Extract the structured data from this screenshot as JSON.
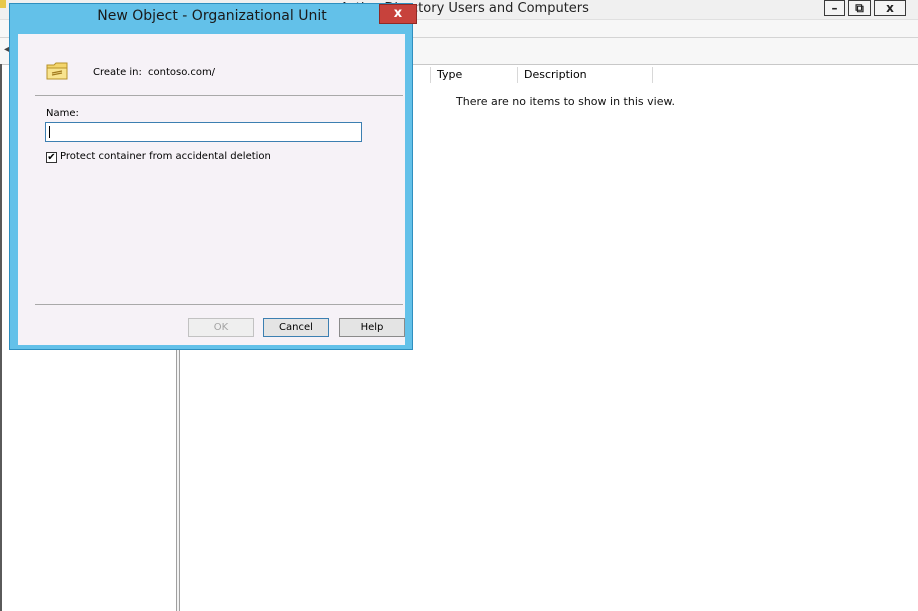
{
  "mmc": {
    "title": "Active Directory Users and Computers",
    "window_buttons": {
      "minimize": "–",
      "restore": "⧉",
      "close": "x"
    },
    "columns": {
      "name": "",
      "type": "Type",
      "description": "Description"
    },
    "empty_message": "There are no items to show in this view."
  },
  "dialog": {
    "title": "New Object - Organizational Unit",
    "close_glyph": "x",
    "create_in_label": "Create in:",
    "create_in_value": "contoso.com/",
    "name_label": "Name:",
    "name_value": "",
    "protect_label": "Protect container from accidental deletion",
    "protect_checked": true,
    "ok_label": "OK",
    "cancel_label": "Cancel",
    "help_label": "Help",
    "ok_enabled": false
  },
  "colors": {
    "dialog_frame": "#63c1e9",
    "close_button": "#c7423c",
    "dialog_body": "#f6f2f7",
    "focus_border": "#3c7fb1"
  },
  "icons": {
    "folder": "ou-folder-icon",
    "check": "✔",
    "back": "◂"
  }
}
